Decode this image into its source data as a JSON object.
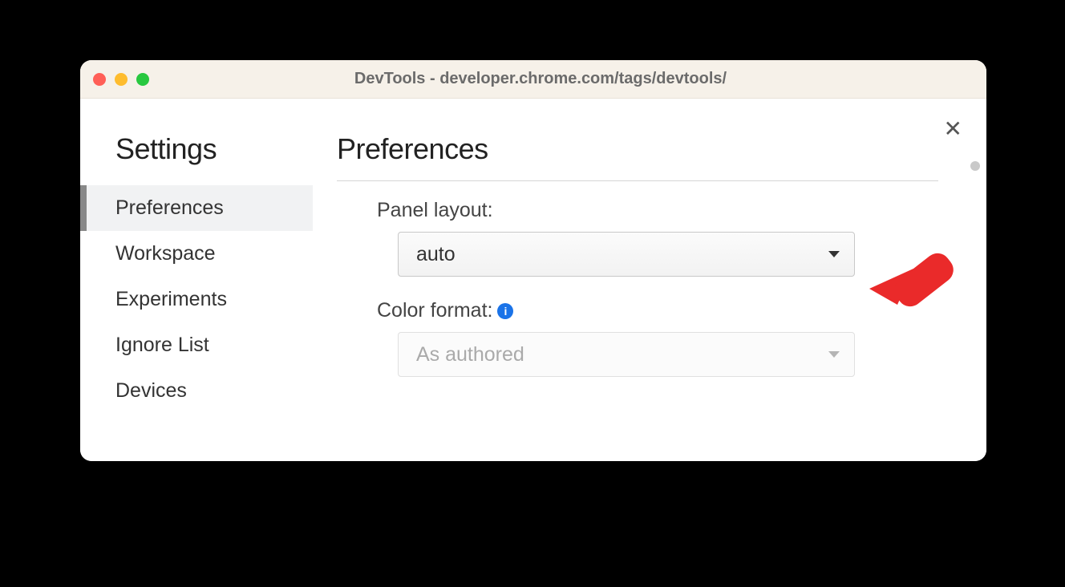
{
  "window": {
    "title": "DevTools - developer.chrome.com/tags/devtools/"
  },
  "sidebar": {
    "title": "Settings",
    "items": [
      {
        "label": "Preferences",
        "active": true
      },
      {
        "label": "Workspace",
        "active": false
      },
      {
        "label": "Experiments",
        "active": false
      },
      {
        "label": "Ignore List",
        "active": false
      },
      {
        "label": "Devices",
        "active": false
      }
    ]
  },
  "main": {
    "title": "Preferences",
    "settings": {
      "panel_layout": {
        "label": "Panel layout:",
        "value": "auto"
      },
      "color_format": {
        "label": "Color format:",
        "value": "As authored",
        "info_icon": "i",
        "disabled": true
      }
    }
  },
  "icons": {
    "close": "✕"
  }
}
